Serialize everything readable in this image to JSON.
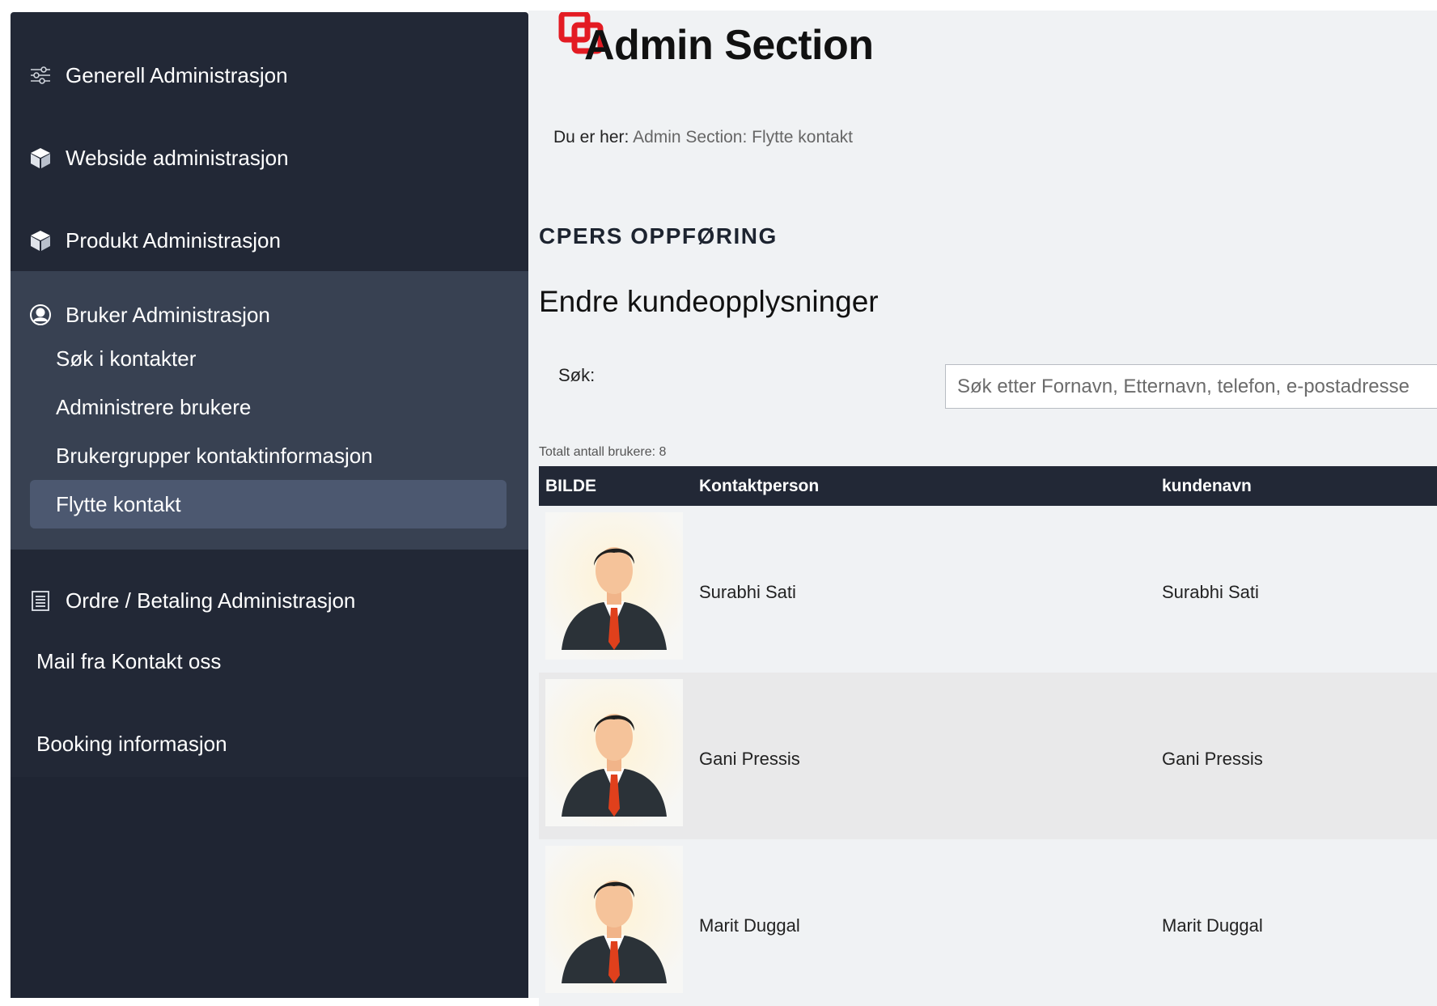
{
  "sidebar": {
    "items": [
      {
        "label": "Generell Administrasjon",
        "icon": "sliders-icon"
      },
      {
        "label": "Webside administrasjon",
        "icon": "box-icon"
      },
      {
        "label": "Produkt Administrasjon",
        "icon": "box-icon"
      },
      {
        "label": "Bruker Administrasjon",
        "icon": "user-circle-icon"
      },
      {
        "label": "Ordre / Betaling Administrasjon",
        "icon": "receipt-icon"
      },
      {
        "label": "Mail fra Kontakt oss"
      },
      {
        "label": "Booking informasjon"
      }
    ],
    "bruker_sub": [
      {
        "label": "Søk i kontakter"
      },
      {
        "label": "Administrere brukere"
      },
      {
        "label": "Brukergrupper kontaktinformasjon"
      },
      {
        "label": "Flytte kontakt",
        "active": true
      }
    ]
  },
  "header": {
    "title": "Admin Section",
    "logo_icon": "logo-icon"
  },
  "breadcrumb": {
    "prefix": "Du er her:",
    "path": "Admin Section: Flytte kontakt"
  },
  "section": {
    "heading": "CPERS OPPFØRING",
    "subheading": "Endre kundeopplysninger"
  },
  "search": {
    "label": "Søk:",
    "placeholder": "Søk etter Fornavn, Etternavn, telefon, e-postadresse"
  },
  "table": {
    "total": "Totalt antall brukere: 8",
    "columns": [
      "BILDE",
      "Kontaktperson",
      "kundenavn"
    ],
    "rows": [
      {
        "kontaktperson": "Surabhi  Sati",
        "kundenavn": "Surabhi Sati"
      },
      {
        "kontaktperson": "Gani Pressis",
        "kundenavn": "Gani Pressis"
      },
      {
        "kontaktperson": "Marit Duggal",
        "kundenavn": "Marit Duggal"
      }
    ]
  },
  "colors": {
    "sidebar_bg": "#222836",
    "sidebar_group_bg": "#384152",
    "active_item_bg": "#4c5870",
    "main_bg": "#f0f2f4",
    "logo_red": "#e31b23"
  }
}
